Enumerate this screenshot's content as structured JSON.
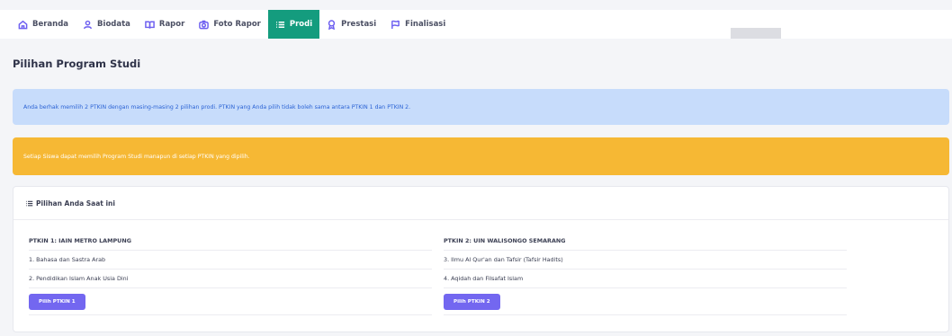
{
  "nav": {
    "items": [
      {
        "label": "Beranda",
        "icon": "home-icon"
      },
      {
        "label": "Biodata",
        "icon": "user-icon"
      },
      {
        "label": "Rapor",
        "icon": "book-open-icon"
      },
      {
        "label": "Foto Rapor",
        "icon": "camera-icon"
      },
      {
        "label": "Prodi",
        "icon": "list-icon",
        "active": true
      },
      {
        "label": "Prestasi",
        "icon": "award-icon"
      },
      {
        "label": "Finalisasi",
        "icon": "flag-icon"
      }
    ],
    "active_color": "#149c7e",
    "icon_color": "#6d5ff0"
  },
  "page": {
    "title": "Pilihan Program Studi"
  },
  "alerts": {
    "info": "Anda berhak memilih 2 PTKIN dengan masing-masing 2 pilihan prodi. PTKIN yang Anda pilih tidak boleh sama antara PTKIN 1 dan PTKIN 2.",
    "warning": "Setiap Siswa dapat memilih Program Studi manapun di setiap PTKIN yang dipilih."
  },
  "card": {
    "title": "Pilihan Anda Saat ini",
    "ptkin1": {
      "heading": "PTKIN 1: IAIN METRO LAMPUNG",
      "choices": [
        "1. Bahasa dan Sastra Arab",
        "2. Pendidikan Islam Anak Usia Dini"
      ],
      "button": "Pilih PTKIN 1"
    },
    "ptkin2": {
      "heading": "PTKIN 2: UIN WALISONGO SEMARANG",
      "choices": [
        "3. Ilmu Al Qur'an dan Tafsir (Tafsir Hadits)",
        "4. Aqidah dan Filsafat Islam"
      ],
      "button": "Pilih PTKIN 2"
    }
  },
  "colors": {
    "primary": "#7367f0",
    "info_bg": "#c7dcfb",
    "warning_bg": "#f6b834"
  }
}
